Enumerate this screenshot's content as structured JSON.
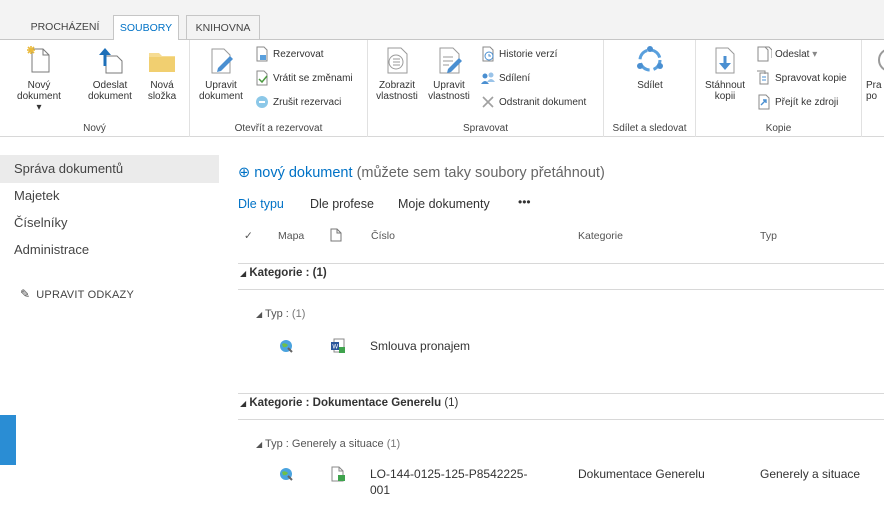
{
  "ribbon_tabs": [
    "PROCHÁZENÍ",
    "SOUBORY",
    "KNIHOVNA"
  ],
  "ribbon_groups": {
    "novy": {
      "label": "Nový",
      "new_document_l1": "Nový",
      "new_document_l2": "dokument",
      "upload_l1": "Odeslat",
      "upload_l2": "dokument",
      "new_folder_l1": "Nová",
      "new_folder_l2": "složka"
    },
    "otevrit": {
      "label": "Otevřít a rezervovat",
      "edit_l1": "Upravit",
      "edit_l2": "dokument",
      "checkout": "Rezervovat",
      "checkin": "Vrátit se změnami",
      "discard": "Zrušit rezervaci"
    },
    "spravovat": {
      "label": "Spravovat",
      "view_props_l1": "Zobrazit",
      "view_props_l2": "vlastnosti",
      "edit_props_l1": "Upravit",
      "edit_props_l2": "vlastnosti",
      "version_history": "Historie verzí",
      "sharing": "Sdílení",
      "delete": "Odstranit dokument"
    },
    "sdilet": {
      "label": "Sdílet a sledovat",
      "share": "Sdílet"
    },
    "kopie": {
      "label": "Kopie",
      "download_l1": "Stáhnout",
      "download_l2": "kopii",
      "send_to": "Odeslat",
      "manage_copies": "Spravovat kopie",
      "go_to_source": "Přejít ke zdroji"
    },
    "cut_off": {
      "l1": "Pra",
      "l2": "po"
    }
  },
  "left_nav": {
    "items": [
      "Správa dokumentů",
      "Majetek",
      "Číselníky",
      "Administrace"
    ],
    "edit_links": "UPRAVIT ODKAZY"
  },
  "main": {
    "new_document_link": "nový dokument",
    "new_document_hint": "(můžete sem taky soubory přetáhnout)",
    "views": [
      "Dle typu",
      "Dle profese",
      "Moje dokumenty"
    ],
    "views_more": "•••",
    "columns": {
      "mapa": "Mapa",
      "cislo": "Číslo",
      "kategorie": "Kategorie",
      "typ": "Typ"
    },
    "groups": [
      {
        "prefix": "Kategorie :",
        "value": "",
        "count": "(1)",
        "sub_prefix": "Typ :",
        "sub_value": "",
        "sub_count": "(1)",
        "row": {
          "cislo": "Smlouva pronajem",
          "kategorie": "",
          "typ": ""
        }
      },
      {
        "prefix": "Kategorie :",
        "value": "Dokumentace Generelu",
        "count": "(1)",
        "sub_prefix": "Typ :",
        "sub_value": "Generely a situace",
        "sub_count": "(1)",
        "row": {
          "cislo_l1": "LO-144-0125-125-P8542225-",
          "cislo_l2": "001",
          "kategorie": "Dokumentace Generelu",
          "typ": "Generely a situace"
        }
      }
    ]
  },
  "colors": {
    "accent": "#0072c6",
    "nav_selected": "#ebebeb",
    "strip": "#2a8dd4"
  }
}
